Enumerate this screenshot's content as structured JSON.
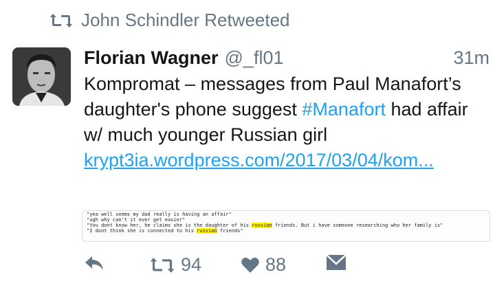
{
  "retweet_context": {
    "text": "John Schindler Retweeted",
    "icon": "retweet-icon"
  },
  "tweet": {
    "display_name": "Florian Wagner",
    "handle": "@_fl01",
    "time": "31m",
    "text_part1": "Kompromat – messages from Paul Manafort’s daughter's phone suggest ",
    "hashtag": "#Manafort",
    "text_part2": " had affair w/ much younger Russian girl",
    "link": "krypt3ia.wordpress.com/2017/03/04/kom..."
  },
  "media": {
    "line0": "\"yea well seems my dad really is having an affair\"",
    "line1": "\"ugh why can't it ever get easier\"",
    "line2_a": "\"You dont know her, he claims she is the daughter of his ",
    "line2_hl": "russian",
    "line2_b": " friends. But i have someone researching who her family is\"",
    "line3_a": "\"I dont think she is connected to his ",
    "line3_hl": "russian",
    "line3_b": " friends\""
  },
  "actions": {
    "reply_icon": "reply-icon",
    "retweet_icon": "retweet-icon",
    "retweet_count": "94",
    "like_icon": "heart-icon",
    "like_count": "88",
    "dm_icon": "envelope-icon"
  },
  "colors": {
    "accent": "#1da1f2",
    "secondary_text": "#657786",
    "highlight": "#fff200"
  }
}
